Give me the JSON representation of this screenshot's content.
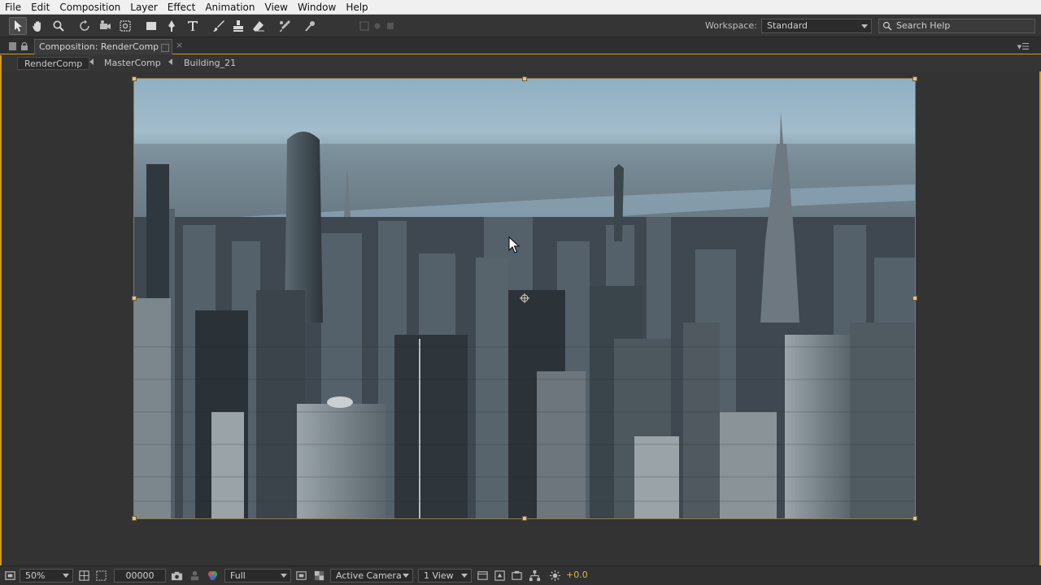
{
  "menubar": {
    "items": [
      "File",
      "Edit",
      "Composition",
      "Layer",
      "Effect",
      "Animation",
      "View",
      "Window",
      "Help"
    ]
  },
  "toolbar": {
    "tools": [
      "selection-tool",
      "hand-tool",
      "zoom-tool",
      "rotation-tool",
      "camera-orbit-tool",
      "pan-behind-tool",
      "rectangle-tool",
      "pen-tool",
      "type-tool",
      "brush-tool",
      "clone-stamp-tool",
      "eraser-tool",
      "roto-brush-tool",
      "puppet-pin-tool"
    ],
    "workspace_label": "Workspace:",
    "workspace_value": "Standard",
    "search_placeholder": "Search Help"
  },
  "panel": {
    "tab_label": "Composition: RenderComp",
    "breadcrumbs": [
      "RenderComp",
      "MasterComp",
      "Building_21"
    ]
  },
  "bottombar": {
    "magnification": "50%",
    "timecode": "00000",
    "resolution": "Full",
    "camera": "Active Camera",
    "views": "1 View",
    "exposure": "+0.0"
  },
  "colors": {
    "accent": "#d49a1a",
    "menubar_bg": "#f0f0f0",
    "panel_bg": "#353535"
  }
}
